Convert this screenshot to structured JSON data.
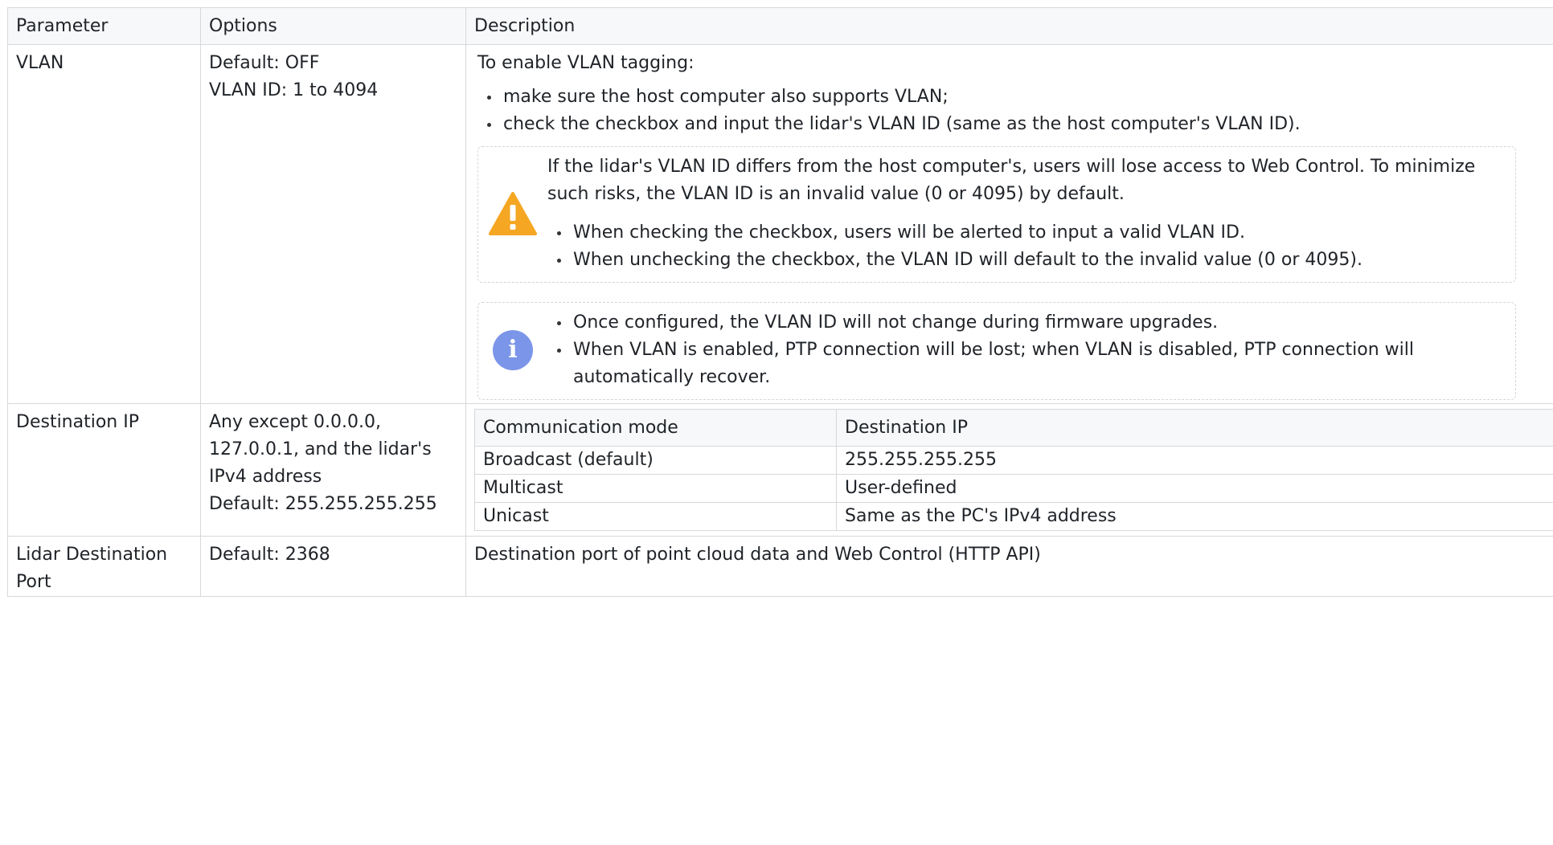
{
  "headers": {
    "parameter": "Parameter",
    "options": "Options",
    "description": "Description"
  },
  "vlan": {
    "name": "VLAN",
    "options": [
      "Default: OFF",
      "VLAN ID: 1 to 4094"
    ],
    "intro": "To enable VLAN tagging:",
    "bullets": [
      "make sure the host computer also supports VLAN;",
      "check the checkbox and input the lidar's VLAN ID (same as the host computer's VLAN ID)."
    ],
    "warning": {
      "icon": "warning-triangle-icon",
      "color": "#f5a623",
      "text": "If the lidar's VLAN ID differs from the host computer's, users will lose access to Web Control. To minimize such risks, the VLAN ID is an invalid value (0 or 4095) by default.",
      "bullets": [
        "When checking the checkbox, users will be alerted to input a valid VLAN ID.",
        "When unchecking the checkbox, the VLAN ID will default to the invalid value (0 or 4095)."
      ]
    },
    "info": {
      "icon": "info-circle-icon",
      "color": "#7b95e8",
      "bullets": [
        "Once configured, the VLAN ID will not change during firmware upgrades.",
        "When VLAN is enabled, PTP connection will be lost; when VLAN is disabled, PTP connection will automatically recover."
      ]
    }
  },
  "dest_ip": {
    "name": "Destination IP",
    "options": [
      "Any except 0.0.0.0, 127.0.0.1, and the lidar's IPv4 address",
      "Default: 255.255.255.255"
    ],
    "table": {
      "headers": [
        "Communication mode",
        "Destination IP"
      ],
      "rows": [
        [
          "Broadcast (default)",
          "255.255.255.255"
        ],
        [
          "Multicast",
          "User-defined"
        ],
        [
          "Unicast",
          "Same as the PC's IPv4 address"
        ]
      ]
    }
  },
  "dest_port": {
    "name": "Lidar Destination Port",
    "options": "Default: 2368",
    "description": "Destination port of point cloud data and Web Control (HTTP API)"
  }
}
